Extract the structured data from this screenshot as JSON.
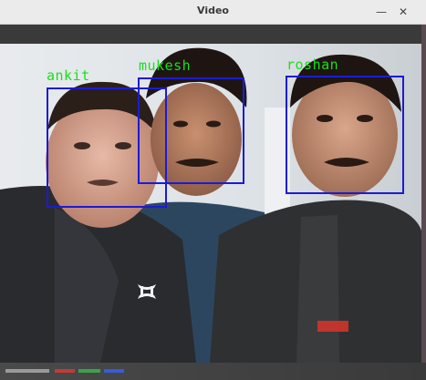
{
  "window": {
    "title": "Video",
    "minimize_glyph": "—",
    "close_glyph": "✕"
  },
  "faces": [
    {
      "label": "ankit"
    },
    {
      "label": "mukesh"
    },
    {
      "label": "roshan"
    }
  ],
  "colors": {
    "box": "#1b1bd6",
    "label": "#18e018",
    "titlebar": "#ebebeb"
  },
  "icons": {
    "minimize": "minimize-icon",
    "close": "close-icon",
    "shirt_logo": "under-armour-logo-icon"
  }
}
